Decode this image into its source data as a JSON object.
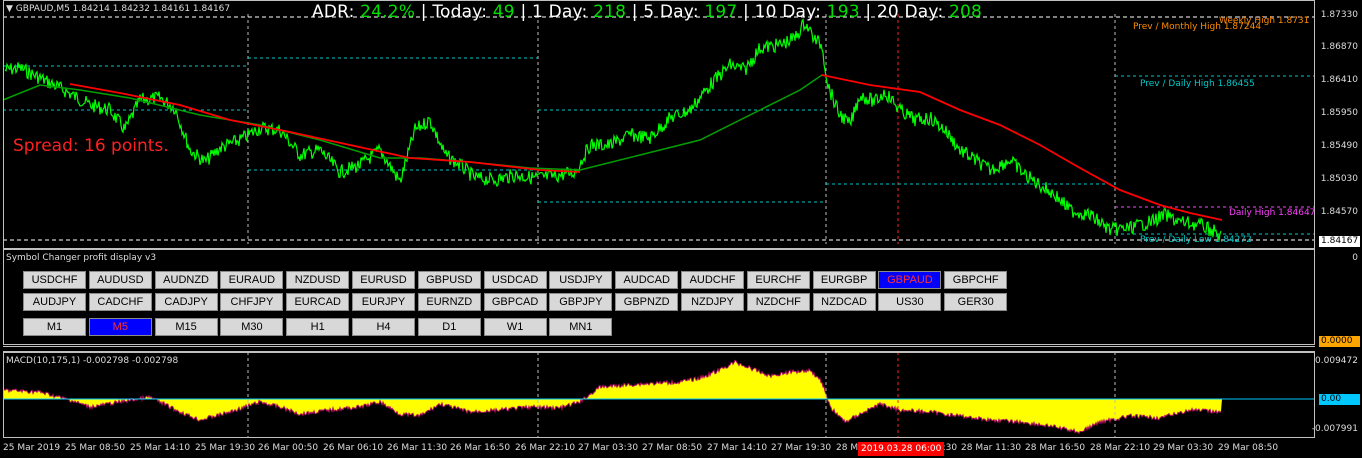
{
  "chart_header": "GBPAUD,M5  1.84214 1.84232 1.84161 1.84167",
  "adr": {
    "label": "ADR:",
    "adr_value": "24.2%",
    "today_label": "| Today:",
    "today_value": "49",
    "d1_label": "  | 1 Day:",
    "d1_value": "218",
    "d5_label": " | 5 Day:",
    "d5_value": "197",
    "d10_label": " | 10 Day:",
    "d10_value": "193",
    "d20_label": " |  20 Day:",
    "d20_value": "208"
  },
  "spread_text": "Spread: 16 points.",
  "levels": {
    "weekly_high": "Weekly High 1.8731",
    "prev_monthly_high": "Prev / Monthly High 1.87244",
    "prev_daily_high": "Prev / Daily High 1.86455",
    "daily_high": "Daily High 1.84647",
    "prev_daily_low": "Prev / Daily Low 1.84272"
  },
  "price_axis": [
    "1.87330",
    "1.86870",
    "1.86410",
    "1.85950",
    "1.85490",
    "1.85030",
    "1.84570"
  ],
  "current_price": "1.84167",
  "indicator_panel": {
    "title": "Symbol Changer profit display v3",
    "axis_top": "0",
    "axis_bottom": "0.0000",
    "symbols_row1": [
      "USDCHF",
      "AUDUSD",
      "AUDNZD",
      "EURAUD",
      "NZDUSD",
      "EURUSD",
      "GBPUSD",
      "USDCAD",
      "USDJPY",
      "AUDCAD",
      "AUDCHF",
      "EURCHF",
      "EURGBP",
      "GBPAUD",
      "GBPCHF"
    ],
    "symbols_row2": [
      "AUDJPY",
      "CADCHF",
      "CADJPY",
      "CHFJPY",
      "EURCAD",
      "EURJPY",
      "EURNZD",
      "GBPCAD",
      "GBPJPY",
      "GBPNZD",
      "NZDJPY",
      "NZDCHF",
      "NZDCAD",
      "US30",
      "GER30"
    ],
    "timeframes": [
      "M1",
      "M5",
      "M15",
      "M30",
      "H1",
      "H4",
      "D1",
      "W1",
      "MN1"
    ],
    "active_symbol": "GBPAUD",
    "active_timeframe": "M5"
  },
  "macd": {
    "title": "MACD(10,175,1) -0.002798 -0.002798",
    "axis_top": "0.009472",
    "axis_zero": "0.00",
    "axis_bottom": "-0.007991"
  },
  "time_axis": [
    "25 Mar 2019",
    "25 Mar 08:50",
    "25 Mar 14:10",
    "25 Mar 19:30",
    "26 Mar 00:50",
    "26 Mar 06:10",
    "26 Mar 11:30",
    "26 Mar 16:50",
    "26 Mar 22:10",
    "27 Mar 03:30",
    "27 Mar 08:50",
    "27 Mar 14:10",
    "27 Mar 19:30",
    "28 Mar",
    "28 Mar 06:30",
    "28 Mar 11:30",
    "28 Mar 16:50",
    "28 Mar 22:10",
    "29 Mar 03:30",
    "29 Mar 08:50"
  ],
  "crosshair_time": "2019.03.28 06:00",
  "colors": {
    "price": "#00ff00",
    "ma_fast": "#ff0000",
    "ma_slow": "#00a000",
    "macd_hist": "#ffff00",
    "button_active": "#0000ff",
    "level_cyan": "#00c8c8",
    "level_orange": "#ff8c00",
    "level_magenta": "#ff40ff"
  }
}
